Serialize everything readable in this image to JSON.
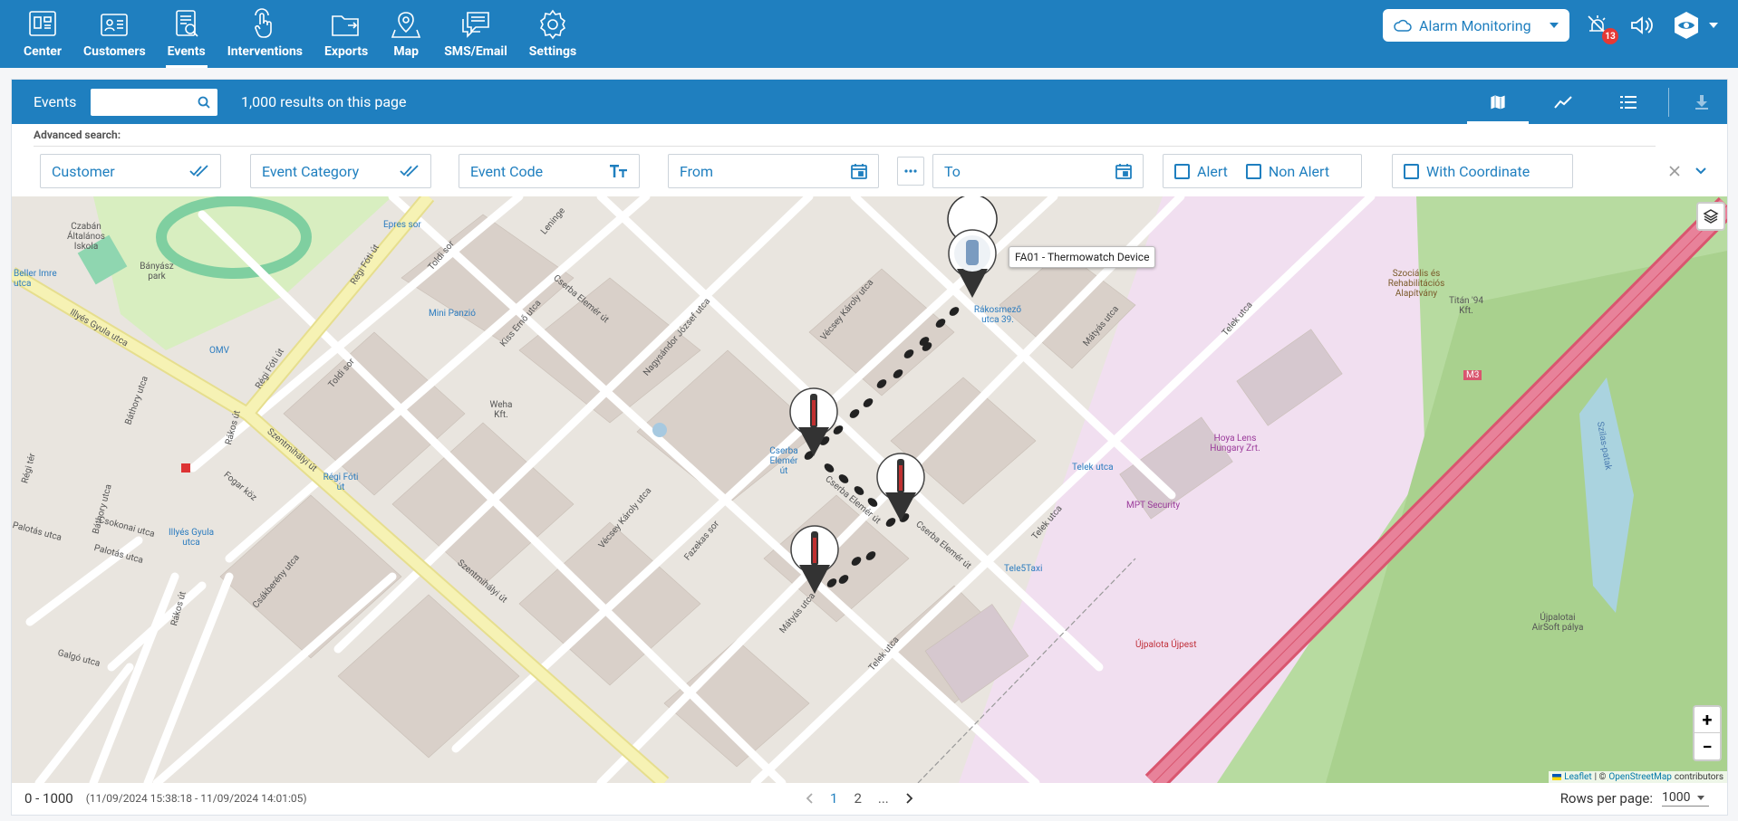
{
  "nav": {
    "items": [
      {
        "label": "Center",
        "icon": "center-icon"
      },
      {
        "label": "Customers",
        "icon": "customers-icon"
      },
      {
        "label": "Events",
        "icon": "events-icon",
        "active": true
      },
      {
        "label": "Interventions",
        "icon": "interventions-icon"
      },
      {
        "label": "Exports",
        "icon": "exports-icon"
      },
      {
        "label": "Map",
        "icon": "map-icon"
      },
      {
        "label": "SMS/Email",
        "icon": "sms-email-icon"
      },
      {
        "label": "Settings",
        "icon": "settings-icon"
      }
    ],
    "mode_label": "Alarm Monitoring",
    "notification_count": "13"
  },
  "events_bar": {
    "title": "Events",
    "search_value": "",
    "results_text": "1,000 results on this page"
  },
  "advanced": {
    "label": "Advanced search:",
    "customer_placeholder": "Customer",
    "category_placeholder": "Event Category",
    "code_placeholder": "Event Code",
    "from_placeholder": "From",
    "to_placeholder": "To",
    "alert_label": "Alert",
    "non_alert_label": "Non Alert",
    "coordinate_label": "With Coordinate"
  },
  "map": {
    "tooltip": "FA01 - Thermowatch Device",
    "attribution_leaflet": "Leaflet",
    "attribution_osm": "OpenStreetMap",
    "attribution_text": "| © ",
    "attribution_suffix": "contributors",
    "labels": {
      "cserba_elemer_ut": "Cserba Elemér út",
      "vecsey_karoly_utca": "Vécsey Károly utca",
      "nagysandor": "Nagysándor József utca",
      "kiss_erno": "Kiss Ernő utca",
      "toldi_sor": "Toldi sor",
      "regi_foti_ut": "Régi Fóti út",
      "illyes_gyula_utca": "Illyés Gyula utca",
      "bathory_utca": "Báthory utca",
      "szentmihalyi_ut": "Szentmihályi út",
      "csakbereny": "Csákberény utca",
      "rakos_ut": "Rákos út",
      "palotas_utca": "Palotás utca",
      "csokonai_utca": "Csokonai utca",
      "galgo_utca": "Galgó utca",
      "fazekas_sor": "Fazekas sor",
      "matyas_utca": "Mátyás utca",
      "telek_utca": "Telek utca",
      "rakosmezo": "Rákosmező utca 39.",
      "mini_panzio": "Mini Panzió",
      "epres_sor": "Epres sor",
      "beller": "Beller Imre utca",
      "omv": "OMV",
      "banyasz_park": "Bányász park",
      "czabane": "Czabán Általános Iskola",
      "weha": "Weha Kft.",
      "hoya": "Hoya Lens Hungary Zrt.",
      "mpt": "MPT Security",
      "tele5": "Tele5Taxi",
      "szocialis": "Szociális és Rehabilitációs Alapítvány",
      "titan": "Titán '94 Kft.",
      "ujpalotai": "Újpalotai AirSoft pálya",
      "ujpalota_ujpest": "Újpalota Újpest",
      "m3": "M3",
      "telek_utca_stop": "Telek utca",
      "cserba_stop": "Cserba Elemér út",
      "regi_foti_stop": "Régi Fóti út",
      "illyes_stop": "Illyés Gyula utca",
      "lemingen": "Leninge",
      "sztas": "Szilas-patak",
      "regi_ter": "Régi tér",
      "foga_koz": "Fogar köz"
    }
  },
  "footer": {
    "range": "0 - 1000",
    "span": "(11/09/2024 15:38:18 - 11/09/2024 14:01:05)",
    "page_1": "1",
    "page_2": "2",
    "ellipsis": "...",
    "rows_label": "Rows per page:",
    "rows_value": "1000"
  },
  "colors": {
    "brand": "#1f7fbf",
    "badge": "#e53935",
    "motorway": "#e8829a",
    "primary_road": "#f6f2b4"
  }
}
